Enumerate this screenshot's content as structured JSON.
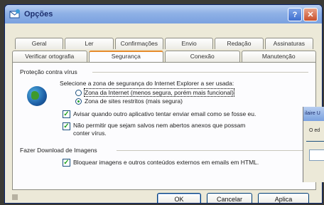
{
  "window": {
    "title": "Opções",
    "help_glyph": "?",
    "close_glyph": "✕"
  },
  "tabs_row1": [
    "Geral",
    "Ler",
    "Confirmações",
    "Envio",
    "Redação",
    "Assinaturas"
  ],
  "tabs_row2": [
    "Verificar ortografia",
    "Segurança",
    "Conexão",
    "Manutenção"
  ],
  "virus": {
    "group_label": "Proteção contra vírus",
    "zone_prompt": "Selecione a zona de segurança do Internet Explorer a ser usada:",
    "radio_internet": "Zona da Internet (menos segura, porém mais funcional)",
    "radio_restricted": "Zona de sites restritos (mais segura)",
    "check_warn_line1": "Avisar quando outro aplicativo tentar enviar email como se fosse eu.",
    "check_block_line1": "Não permitir que sejam salvos nem abertos anexos que possam",
    "check_block_line2": "conter vírus."
  },
  "download": {
    "group_label": "Fazer Download de Imagens",
    "check_block_images": "Bloquear imagens e outros conteúdos externos em emails em HTML."
  },
  "buttons": {
    "ok": "OK",
    "cancel": "Cancelar",
    "apply": "Aplica"
  },
  "overlap_window": {
    "title_fragment": "ilaire U",
    "text_fragment": "O ed"
  },
  "colors": {
    "title_bar": "#8fb1e6",
    "active_tab_accent": "#e68b2c",
    "check_green": "#21a121"
  }
}
